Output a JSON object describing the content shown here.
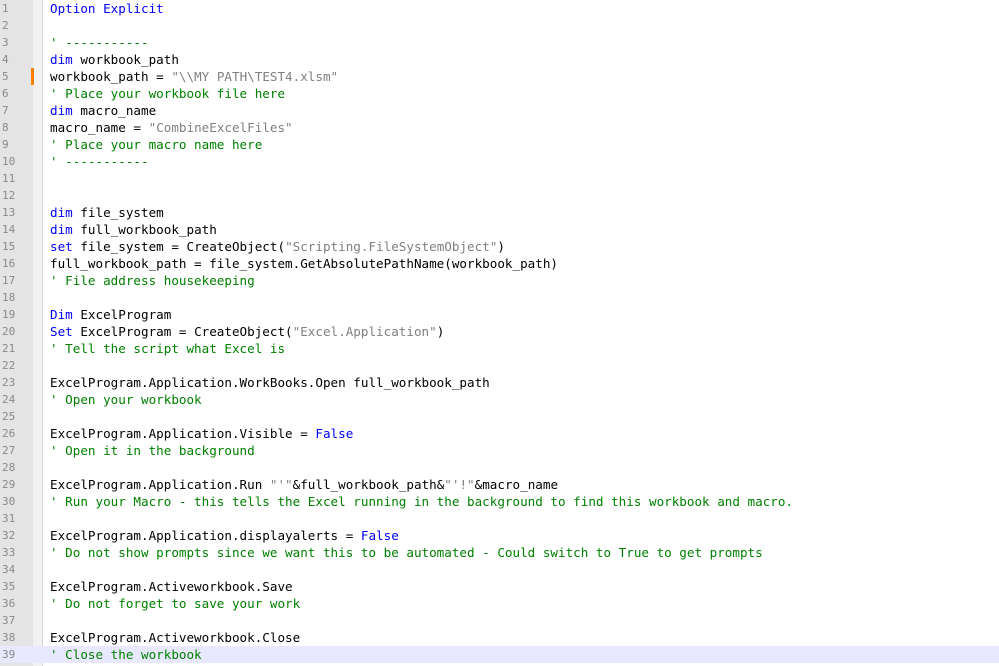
{
  "editor": {
    "colors": {
      "keyword": "#0000ff",
      "string": "#808080",
      "comment": "#008000",
      "text": "#000000",
      "current_line": "#e8e8ff",
      "modified_marker": "#ff8000"
    },
    "lines": [
      {
        "num": "1",
        "tokens": [
          {
            "t": "Option Explicit",
            "c": "kw"
          }
        ]
      },
      {
        "num": "2",
        "tokens": []
      },
      {
        "num": "3",
        "tokens": [
          {
            "t": "' -----------",
            "c": "cmt"
          }
        ]
      },
      {
        "num": "4",
        "tokens": [
          {
            "t": "dim",
            "c": "kw"
          },
          {
            "t": " workbook_path",
            "c": "plain"
          }
        ]
      },
      {
        "num": "5",
        "tokens": [
          {
            "t": "workbook_path = ",
            "c": "plain"
          },
          {
            "t": "\"\\\\MY PATH\\TEST4.xlsm\"",
            "c": "str"
          }
        ],
        "modified": true
      },
      {
        "num": "6",
        "tokens": [
          {
            "t": "' Place your workbook file here",
            "c": "cmt"
          }
        ]
      },
      {
        "num": "7",
        "tokens": [
          {
            "t": "dim",
            "c": "kw"
          },
          {
            "t": " macro_name",
            "c": "plain"
          }
        ]
      },
      {
        "num": "8",
        "tokens": [
          {
            "t": "macro_name = ",
            "c": "plain"
          },
          {
            "t": "\"CombineExcelFiles\"",
            "c": "str"
          }
        ]
      },
      {
        "num": "9",
        "tokens": [
          {
            "t": "' Place your macro name here",
            "c": "cmt"
          }
        ]
      },
      {
        "num": "10",
        "tokens": [
          {
            "t": "' -----------",
            "c": "cmt"
          }
        ]
      },
      {
        "num": "11",
        "tokens": []
      },
      {
        "num": "12",
        "tokens": []
      },
      {
        "num": "13",
        "tokens": [
          {
            "t": "dim",
            "c": "kw"
          },
          {
            "t": " file_system",
            "c": "plain"
          }
        ]
      },
      {
        "num": "14",
        "tokens": [
          {
            "t": "dim",
            "c": "kw"
          },
          {
            "t": " full_workbook_path",
            "c": "plain"
          }
        ]
      },
      {
        "num": "15",
        "tokens": [
          {
            "t": "set",
            "c": "kw"
          },
          {
            "t": " file_system = CreateObject(",
            "c": "plain"
          },
          {
            "t": "\"Scripting.FileSystemObject\"",
            "c": "str"
          },
          {
            "t": ")",
            "c": "plain"
          }
        ]
      },
      {
        "num": "16",
        "tokens": [
          {
            "t": "full_workbook_path = file_system.GetAbsolutePathName(workbook_path)",
            "c": "plain"
          }
        ]
      },
      {
        "num": "17",
        "tokens": [
          {
            "t": "' File address housekeeping",
            "c": "cmt"
          }
        ]
      },
      {
        "num": "18",
        "tokens": []
      },
      {
        "num": "19",
        "tokens": [
          {
            "t": "Dim",
            "c": "kw"
          },
          {
            "t": " ExcelProgram",
            "c": "plain"
          }
        ]
      },
      {
        "num": "20",
        "tokens": [
          {
            "t": "Set",
            "c": "kw"
          },
          {
            "t": " ExcelProgram = CreateObject(",
            "c": "plain"
          },
          {
            "t": "\"Excel.Application\"",
            "c": "str"
          },
          {
            "t": ")",
            "c": "plain"
          }
        ]
      },
      {
        "num": "21",
        "tokens": [
          {
            "t": "' Tell the script what Excel is",
            "c": "cmt"
          }
        ]
      },
      {
        "num": "22",
        "tokens": []
      },
      {
        "num": "23",
        "tokens": [
          {
            "t": "ExcelProgram.Application.WorkBooks.Open full_workbook_path",
            "c": "plain"
          }
        ]
      },
      {
        "num": "24",
        "tokens": [
          {
            "t": "' Open your workbook",
            "c": "cmt"
          }
        ]
      },
      {
        "num": "25",
        "tokens": []
      },
      {
        "num": "26",
        "tokens": [
          {
            "t": "ExcelProgram.Application.Visible = ",
            "c": "plain"
          },
          {
            "t": "False",
            "c": "kw"
          }
        ]
      },
      {
        "num": "27",
        "tokens": [
          {
            "t": "' Open it in the background",
            "c": "cmt"
          }
        ]
      },
      {
        "num": "28",
        "tokens": []
      },
      {
        "num": "29",
        "tokens": [
          {
            "t": "ExcelProgram.Application.Run ",
            "c": "plain"
          },
          {
            "t": "\"'\"",
            "c": "str"
          },
          {
            "t": "&full_workbook_path&",
            "c": "plain"
          },
          {
            "t": "\"'!\"",
            "c": "str"
          },
          {
            "t": "&macro_name",
            "c": "plain"
          }
        ]
      },
      {
        "num": "30",
        "tokens": [
          {
            "t": "' Run your Macro - this tells the Excel running in the background to find this workbook and macro.",
            "c": "cmt"
          }
        ]
      },
      {
        "num": "31",
        "tokens": []
      },
      {
        "num": "32",
        "tokens": [
          {
            "t": "ExcelProgram.Application.displayalerts = ",
            "c": "plain"
          },
          {
            "t": "False",
            "c": "kw"
          }
        ]
      },
      {
        "num": "33",
        "tokens": [
          {
            "t": "' Do not show prompts since we want this to be automated - Could switch to True to get prompts",
            "c": "cmt"
          }
        ]
      },
      {
        "num": "34",
        "tokens": []
      },
      {
        "num": "35",
        "tokens": [
          {
            "t": "ExcelProgram.Activeworkbook.Save",
            "c": "plain"
          }
        ]
      },
      {
        "num": "36",
        "tokens": [
          {
            "t": "' Do not forget to save your work",
            "c": "cmt"
          }
        ]
      },
      {
        "num": "37",
        "tokens": []
      },
      {
        "num": "38",
        "tokens": [
          {
            "t": "ExcelProgram.Activeworkbook.Close",
            "c": "plain"
          }
        ]
      },
      {
        "num": "39",
        "tokens": [
          {
            "t": "' Close the workbook",
            "c": "cmt"
          }
        ],
        "current": true
      }
    ]
  }
}
